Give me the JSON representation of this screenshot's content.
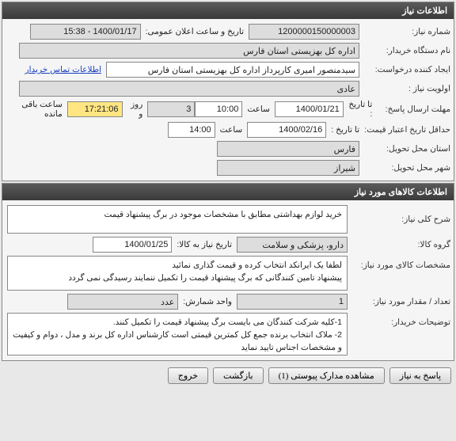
{
  "panel1": {
    "title": "اطلاعات نیاز",
    "need_no_label": "شماره نیاز:",
    "need_no": "1200000150000003",
    "pub_datetime_label": "تاریخ و ساعت اعلان عمومی:",
    "pub_datetime": "1400/01/17 - 15:38",
    "buyer_org_label": "نام دستگاه خریدار:",
    "buyer_org": "اداره کل بهزیستی استان فارس",
    "creator_label": "ایجاد کننده درخواست:",
    "creator": "سیدمنصور امیری کارپرداز اداره کل بهزیستی استان فارس",
    "buyer_contact_link": "اطلاعات تماس خریدار",
    "priority_label": "اولویت نیاز :",
    "priority": "عادی",
    "deadline_label": "مهلت ارسال پاسخ:",
    "deadline_to_label": "تا تاریخ :",
    "deadline_date": "1400/01/21",
    "time_label": "ساعت",
    "deadline_time": "10:00",
    "remain_days": "3",
    "remain_days_label": "روز و",
    "remain_time": "17:21:06",
    "remain_suffix": "ساعت باقی مانده",
    "min_valid_label": "حداقل تاریخ اعتبار قیمت:",
    "min_valid_to_label": "تا تاریخ :",
    "min_valid_date": "1400/02/16",
    "min_valid_time": "14:00",
    "province_label": "استان محل تحویل:",
    "province": "فارس",
    "city_label": "شهر محل تحویل:",
    "city": "شیراز"
  },
  "panel2": {
    "title": "اطلاعات کالاهای مورد نیاز",
    "need_desc_label": "شرح کلی نیاز:",
    "need_desc": "خرید لوازم بهداشتی مطابق با مشخصات موجود در برگ پیشنهاد قیمت",
    "goods_group_label": "گروه کالا:",
    "goods_group": "دارو، پزشکی و سلامت",
    "need_date_to_label": "تاریخ نیاز به کالا:",
    "need_date_to": "1400/01/25",
    "spec_label": "مشخصات کالای مورد نیاز:",
    "spec_text": "لطفا یک ایرانکد انتخاب کرده و قیمت گذاری نمائید\nپیشنهاد تامین کنندگانی که برگ پیشنهاد قیمت را تکمیل ننمایند رسیدگی نمی گردد",
    "qty_label": "تعداد / مقدار مورد نیاز:",
    "qty": "1",
    "unit_label": "واحد شمارش:",
    "unit": "عدد",
    "buyer_notes_label": "توضیحات خریدار:",
    "buyer_notes": "1-کلیه شرکت کنندگان می بایست برگ پیشنهاد قیمت را تکمیل کنند.\n2- ملاک انتخاب برنده جمع کل کمترین قیمتی است کارشناس اداره کل برند و مدل ، دوام و کیفیت و مشخصات  اجناس تایید نماید"
  },
  "buttons": {
    "reply": "پاسخ به نیاز",
    "attachments": "مشاهده مدارک پیوستی (1)",
    "back": "بازگشت",
    "exit": "خروج"
  }
}
